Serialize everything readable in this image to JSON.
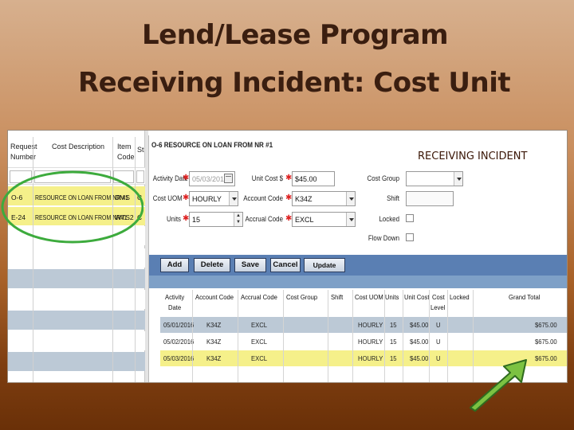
{
  "slide": {
    "title_line1": "Lend/Lease Program",
    "title_line2": "Receiving Incident: Cost Unit"
  },
  "left_panel": {
    "headers": [
      "Request",
      "Number",
      "Cost Description",
      "Item",
      "Code",
      "St"
    ],
    "rows": [
      {
        "number": "O-6",
        "description": "RESOURCE ON LOAN FROM NR #1",
        "code": "DMS",
        "extra": "C"
      },
      {
        "number": "E-24",
        "description": "RESOURCE ON LOAN FROM NR#1",
        "code": "WTS2",
        "extra": "C"
      }
    ]
  },
  "detail": {
    "header": "O-6   RESOURCE ON LOAN FROM NR #1",
    "label": "RECEIVING INCIDENT",
    "form": {
      "activity_date_label": "Activity Date",
      "activity_date_value": "05/03/2016",
      "cost_uom_label": "Cost UOM",
      "cost_uom_value": "HOURLY",
      "units_label": "Units",
      "units_value": "15",
      "unit_cost_label": "Unit Cost $",
      "unit_cost_value": "$45.00",
      "account_code_label": "Account Code",
      "account_code_value": "K34Z",
      "accrual_code_label": "Accrual Code",
      "accrual_code_value": "EXCL",
      "cost_group_label": "Cost Group",
      "shift_label": "Shift",
      "locked_label": "Locked",
      "flow_down_label": "Flow Down"
    },
    "toolbar": {
      "add": "Add",
      "delete": "Delete",
      "save": "Save",
      "cancel": "Cancel",
      "update_rates": "Update Rates"
    },
    "grid": {
      "headers": {
        "activity_date_1": "Activity",
        "activity_date_2": "Date",
        "account_code": "Account Code",
        "accrual_code": "Accrual Code",
        "cost_group": "Cost Group",
        "shift": "Shift",
        "cost_uom": "Cost UOM",
        "units": "Units",
        "unit_cost": "Unit Cost",
        "cost_level_1": "Cost",
        "cost_level_2": "Level",
        "locked": "Locked",
        "grand_total": "Grand Total"
      },
      "rows": [
        {
          "date": "05/01/2016",
          "account": "K34Z",
          "accrual": "EXCL",
          "uom": "HOURLY",
          "units": "15",
          "unit_cost": "$45.00",
          "level": "U",
          "total": "$675.00"
        },
        {
          "date": "05/02/2016",
          "account": "K34Z",
          "accrual": "EXCL",
          "uom": "HOURLY",
          "units": "15",
          "unit_cost": "$45.00",
          "level": "U",
          "total": "$675.00"
        },
        {
          "date": "05/03/2016",
          "account": "K34Z",
          "accrual": "EXCL",
          "uom": "HOURLY",
          "units": "15",
          "unit_cost": "$45.00",
          "level": "U",
          "total": "$675.00"
        }
      ]
    }
  },
  "colors": {
    "highlight_yellow": "#f5f08a",
    "row_blue": "#bcc9d6",
    "toolbar_blue": "#5a7fb3",
    "annotation_green": "#3dab3d",
    "arrow_green": "#7cc242"
  }
}
